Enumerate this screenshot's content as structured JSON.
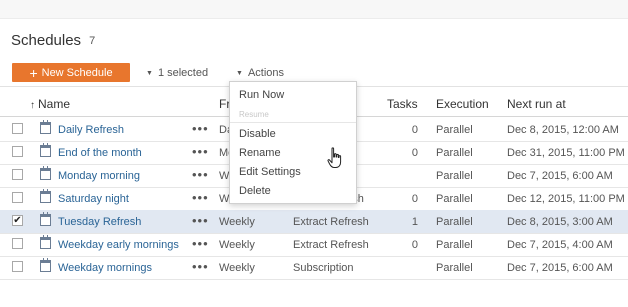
{
  "page": {
    "title": "Schedules",
    "count": "7"
  },
  "toolbar": {
    "new_label": "New Schedule",
    "new_icon": "plus-icon",
    "selected_label": "1 selected",
    "actions_label": "Actions",
    "accent": "#e8762d"
  },
  "table": {
    "headers": {
      "name": "Name",
      "frequency": "Fr",
      "tasks": "Tasks",
      "execution": "Execution",
      "next_run": "Next run at"
    },
    "rows": [
      {
        "checked": false,
        "name": "Daily Refresh",
        "frequency": "Da",
        "type": "ract Refresh",
        "tasks": "0",
        "execution": "Parallel",
        "next_run": "Dec 8, 2015, 12:00 AM"
      },
      {
        "checked": false,
        "name": "End of the month",
        "frequency": "Mo",
        "type": "ct Refresh",
        "tasks": "0",
        "execution": "Parallel",
        "next_run": "Dec 31, 2015, 11:00 PM"
      },
      {
        "checked": false,
        "name": "Monday morning",
        "frequency": "Week",
        "type": "",
        "tasks": "",
        "execution": "Parallel",
        "next_run": "Dec 7, 2015, 6:00 AM"
      },
      {
        "checked": false,
        "name": "Saturday night",
        "frequency": "Week",
        "type": "ract Refresh",
        "tasks": "0",
        "execution": "Parallel",
        "next_run": "Dec 12, 2015, 11:00 PM"
      },
      {
        "checked": true,
        "name": "Tuesday Refresh",
        "frequency": "Weekly",
        "type": "Extract Refresh",
        "tasks": "1",
        "execution": "Parallel",
        "next_run": "Dec 8, 2015, 3:00 AM"
      },
      {
        "checked": false,
        "name": "Weekday early mornings",
        "frequency": "Weekly",
        "type": "Extract Refresh",
        "tasks": "0",
        "execution": "Parallel",
        "next_run": "Dec 7, 2015, 4:00 AM"
      },
      {
        "checked": false,
        "name": "Weekday mornings",
        "frequency": "Weekly",
        "type": "Subscription",
        "tasks": "",
        "execution": "Parallel",
        "next_run": "Dec 7, 2015, 6:00 AM"
      }
    ]
  },
  "actions_menu": {
    "items": [
      "Run Now",
      "Resume",
      "Disable",
      "Rename",
      "Edit Settings",
      "Delete"
    ]
  }
}
